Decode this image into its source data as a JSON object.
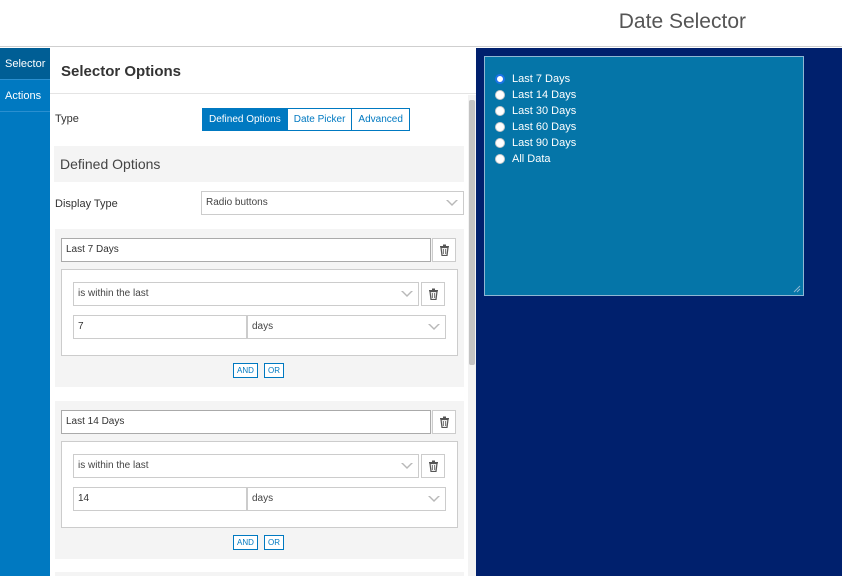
{
  "app": {
    "title": "Date Selector"
  },
  "nav": {
    "items": [
      {
        "label": "Selector",
        "active": true
      },
      {
        "label": "Actions",
        "active": false
      }
    ]
  },
  "panel": {
    "title": "Selector Options",
    "type_label": "Type",
    "type_options": [
      "Defined Options",
      "Date Picker",
      "Advanced"
    ],
    "type_selected": "Defined Options",
    "section_title": "Defined Options",
    "display_type_label": "Display Type",
    "display_type_value": "Radio buttons",
    "options": [
      {
        "name": "Last 7 Days",
        "condition": "is within the last",
        "amount": "7",
        "unit": "days"
      },
      {
        "name": "Last 14 Days",
        "condition": "is within the last",
        "amount": "14",
        "unit": "days"
      }
    ],
    "and_label": "AND",
    "or_label": "OR"
  },
  "preview": {
    "radios": [
      "Last 7 Days",
      "Last 14 Days",
      "Last 30 Days",
      "Last 60 Days",
      "Last 90 Days",
      "All Data"
    ],
    "selected": "Last 7 Days"
  },
  "colors": {
    "accent": "#0079c1",
    "preview_bg": "#00206d",
    "preview_box": "#0575a8"
  }
}
